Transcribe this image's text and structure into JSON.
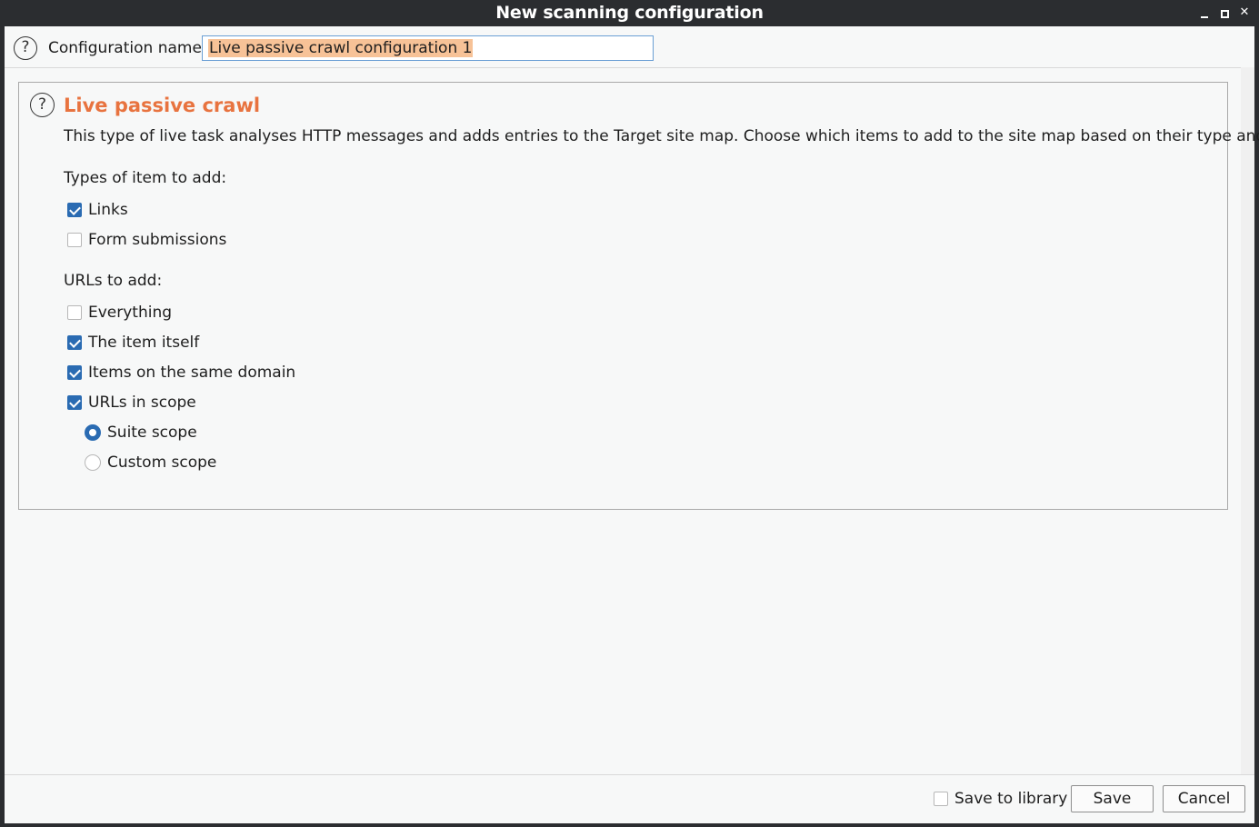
{
  "window": {
    "title": "New scanning configuration",
    "controls": [
      "minimize-icon",
      "maximize-icon",
      "close-icon"
    ]
  },
  "config_name": {
    "label": "Configuration name:",
    "value": "Live passive crawl configuration 1"
  },
  "panel": {
    "title": "Live passive crawl",
    "description": "This type of live task analyses HTTP messages and adds entries to the Target site map. Choose which items to add to the site map based on their type and URL.",
    "types_label": "Types of item to add:",
    "types": [
      {
        "label": "Links",
        "checked": true
      },
      {
        "label": "Form submissions",
        "checked": false
      }
    ],
    "urls_label": "URLs to add:",
    "urls": [
      {
        "label": "Everything",
        "checked": false
      },
      {
        "label": "The item itself",
        "checked": true
      },
      {
        "label": "Items on the same domain",
        "checked": true
      },
      {
        "label": "URLs in scope",
        "checked": true
      }
    ],
    "scope_options": [
      {
        "label": "Suite scope",
        "selected": true
      },
      {
        "label": "Custom scope",
        "selected": false
      }
    ]
  },
  "footer": {
    "save_to_library_label": "Save to library",
    "save_to_library_checked": false,
    "save_label": "Save",
    "cancel_label": "Cancel"
  },
  "colors": {
    "accent": "#e8733f",
    "checkbox_checked": "#2a6bb2",
    "selection_highlight": "#f7c297",
    "titlebar": "#2b2d30"
  }
}
